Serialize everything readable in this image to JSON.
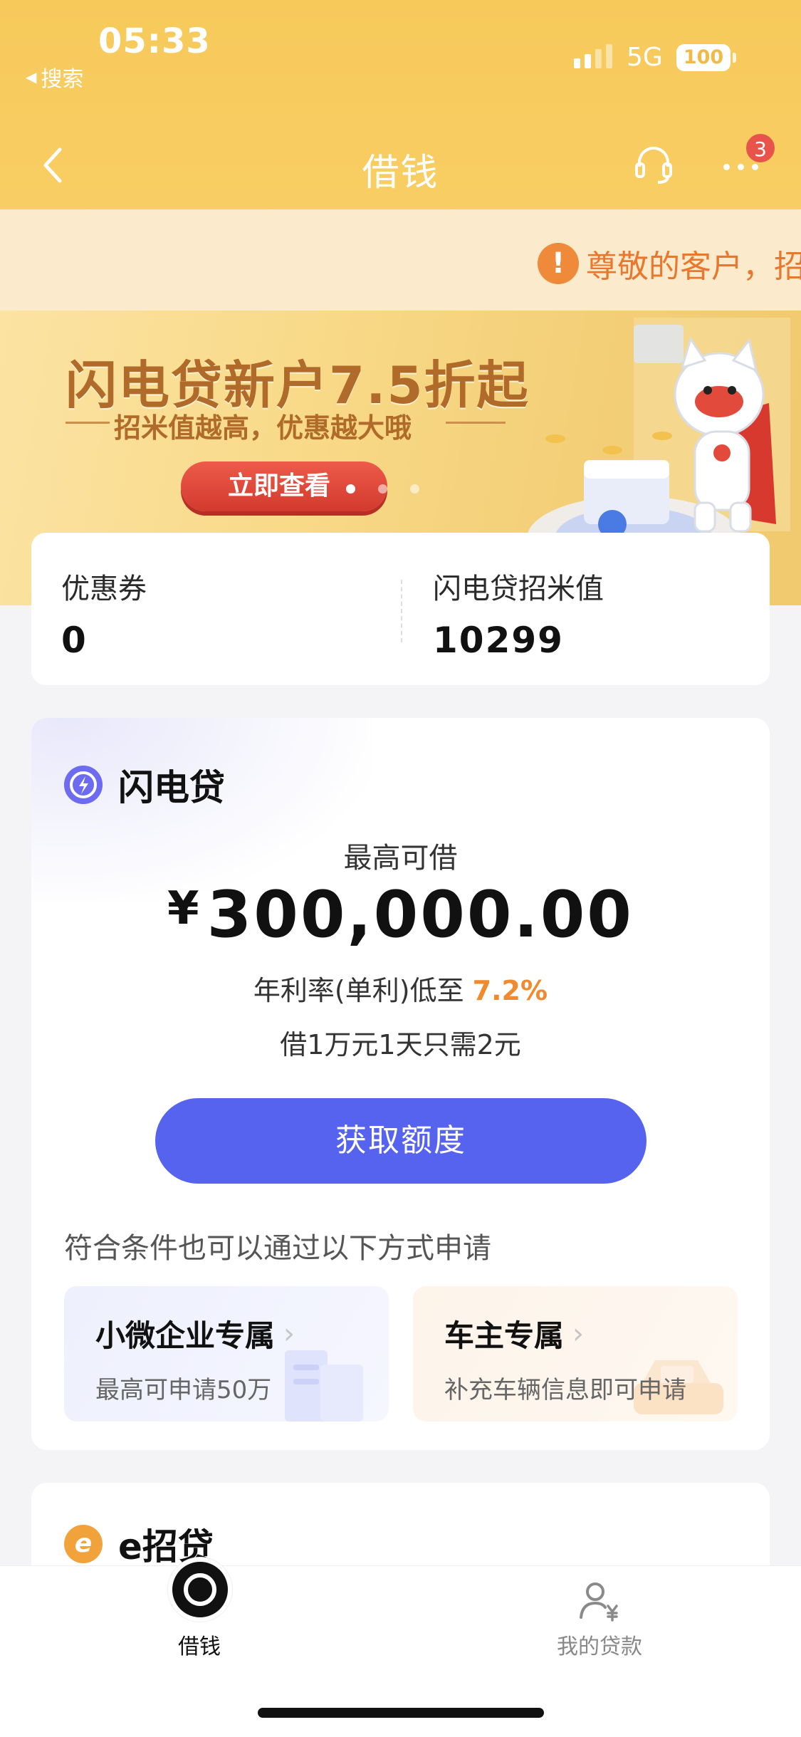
{
  "status_bar": {
    "time": "05:33",
    "back_app": "搜索",
    "network": "5G",
    "battery": "100"
  },
  "nav": {
    "title": "借钱",
    "badge_count": "3"
  },
  "notice": {
    "text": "尊敬的客户，招"
  },
  "banner": {
    "title": "闪电贷新户7.5折起",
    "subtitle": "招米值越高，优惠越大哦",
    "button": "立即查看"
  },
  "stats": {
    "coupon_label": "优惠券",
    "coupon_value": "0",
    "points_label": "闪电贷招米值",
    "points_value": "10299"
  },
  "loan": {
    "title": "闪电贷",
    "max_label": "最高可借",
    "currency": "¥",
    "amount": "300,000.00",
    "rate_prefix": "年利率(单利)低至",
    "rate_value": "7.2%",
    "note": "借1万元1天只需2元",
    "button": "获取额度",
    "alt_heading": "符合条件也可以通过以下方式申请",
    "alt_options": [
      {
        "title": "小微企业专属",
        "subtitle": "最高可申请50万"
      },
      {
        "title": "车主专属",
        "subtitle": "补充车辆信息即可申请"
      }
    ]
  },
  "e_loan": {
    "title": "e招贷"
  },
  "tabbar": {
    "tabs": [
      {
        "label": "借钱",
        "active": true
      },
      {
        "label": "我的贷款",
        "active": false
      }
    ]
  },
  "colors": {
    "accent": "#5563ef",
    "header": "#f8cd62",
    "rate_highlight": "#f08a2f",
    "notice": "#e9782e"
  }
}
